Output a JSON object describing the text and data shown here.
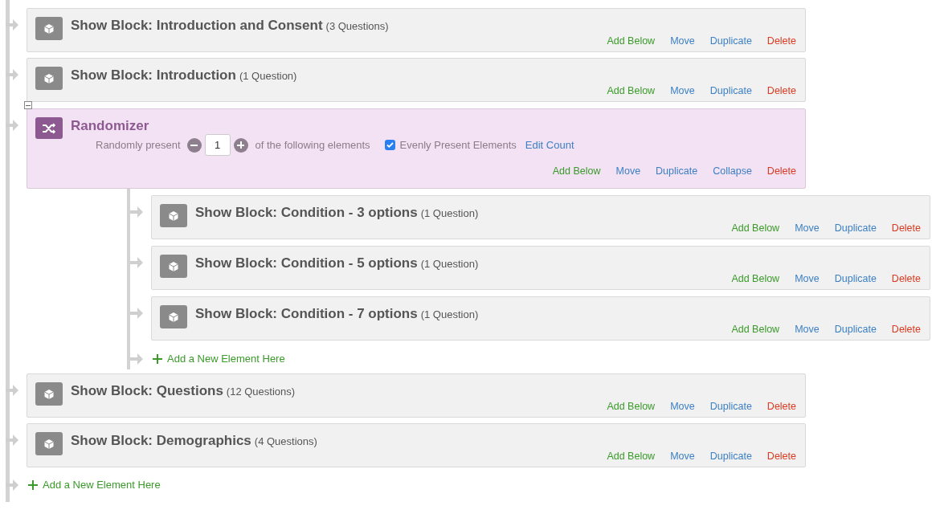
{
  "flow": [
    {
      "kind": "block",
      "title": "Show Block: Introduction and Consent",
      "count": "(3 Questions)",
      "actions": [
        {
          "label": "Add Below",
          "kind": "add"
        },
        {
          "label": "Move",
          "kind": "link"
        },
        {
          "label": "Duplicate",
          "kind": "link"
        },
        {
          "label": "Delete",
          "kind": "delete"
        }
      ]
    },
    {
      "kind": "block",
      "title": "Show Block: Introduction",
      "count": "(1 Question)",
      "actions": [
        {
          "label": "Add Below",
          "kind": "add"
        },
        {
          "label": "Move",
          "kind": "link"
        },
        {
          "label": "Duplicate",
          "kind": "link"
        },
        {
          "label": "Delete",
          "kind": "delete"
        }
      ]
    },
    {
      "kind": "randomizer",
      "title": "Randomizer",
      "expanded": true,
      "present_label": "Randomly present",
      "present_count": "1",
      "present_suffix": "of the following elements",
      "evenly": {
        "label": "Evenly Present Elements",
        "checked": true
      },
      "edit_count": "Edit Count",
      "actions": [
        {
          "label": "Add Below",
          "kind": "add"
        },
        {
          "label": "Move",
          "kind": "link"
        },
        {
          "label": "Duplicate",
          "kind": "link"
        },
        {
          "label": "Collapse",
          "kind": "link"
        },
        {
          "label": "Delete",
          "kind": "delete"
        }
      ],
      "children": [
        {
          "kind": "block",
          "title": "Show Block: Condition - 3 options",
          "count": "(1 Question)",
          "actions": [
            {
              "label": "Add Below",
              "kind": "add"
            },
            {
              "label": "Move",
              "kind": "link"
            },
            {
              "label": "Duplicate",
              "kind": "link"
            },
            {
              "label": "Delete",
              "kind": "delete"
            }
          ]
        },
        {
          "kind": "block",
          "title": "Show Block: Condition - 5 options",
          "count": "(1 Question)",
          "actions": [
            {
              "label": "Add Below",
              "kind": "add"
            },
            {
              "label": "Move",
              "kind": "link"
            },
            {
              "label": "Duplicate",
              "kind": "link"
            },
            {
              "label": "Delete",
              "kind": "delete"
            }
          ]
        },
        {
          "kind": "block",
          "title": "Show Block: Condition - 7 options",
          "count": "(1 Question)",
          "actions": [
            {
              "label": "Add Below",
              "kind": "add"
            },
            {
              "label": "Move",
              "kind": "link"
            },
            {
              "label": "Duplicate",
              "kind": "link"
            },
            {
              "label": "Delete",
              "kind": "delete"
            }
          ]
        }
      ],
      "add_element": "Add a New Element Here"
    },
    {
      "kind": "block",
      "title": "Show Block: Questions",
      "count": "(12 Questions)",
      "actions": [
        {
          "label": "Add Below",
          "kind": "add"
        },
        {
          "label": "Move",
          "kind": "link"
        },
        {
          "label": "Duplicate",
          "kind": "link"
        },
        {
          "label": "Delete",
          "kind": "delete"
        }
      ]
    },
    {
      "kind": "block",
      "title": "Show Block: Demographics",
      "count": "(4 Questions)",
      "actions": [
        {
          "label": "Add Below",
          "kind": "add"
        },
        {
          "label": "Move",
          "kind": "link"
        },
        {
          "label": "Duplicate",
          "kind": "link"
        },
        {
          "label": "Delete",
          "kind": "delete"
        }
      ]
    }
  ],
  "add_element": "Add a New Element Here"
}
